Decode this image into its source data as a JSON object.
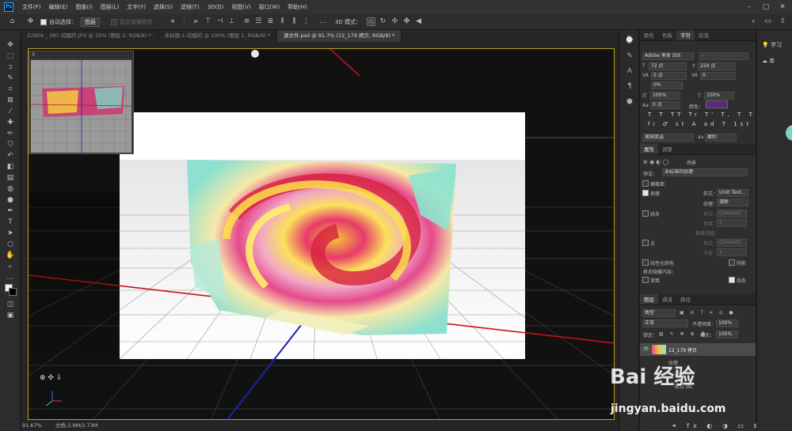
{
  "app": {
    "logo": "Ps"
  },
  "menubar": {
    "items": [
      "文件(F)",
      "编辑(E)",
      "图像(I)",
      "图层(L)",
      "文字(Y)",
      "选择(S)",
      "滤镜(T)",
      "3D(D)",
      "视图(V)",
      "窗口(W)",
      "帮助(H)"
    ]
  },
  "optionsbar": {
    "auto_select_label": "自动选择：",
    "auto_select_value": "图层",
    "show_transform_label": "显示变换控件",
    "mode_3d_label": "3D 模式："
  },
  "tabs": [
    {
      "label": "Z2809 _ 081-炫酷的.JPG @ 25% (图层 2, RGB/8) *",
      "active": false
    },
    {
      "label": "未标题-1-炫酷的 @ 100% (图层 1, RGB/8) *",
      "active": false
    },
    {
      "label": "源文件.psd @ 91.7% (12_179 拷贝, RGB/8) *",
      "active": true
    }
  ],
  "status": {
    "zoom": "91.67%",
    "doc_size": "文档:2.9M/2.73M"
  },
  "character_panel": {
    "tabs": [
      "颜色",
      "色板",
      "字符",
      "段落"
    ],
    "active_tab": "字符",
    "font_family": "Adobe 黑体 Std",
    "font_style": "-",
    "font_size": "72 点",
    "leading": "224 点",
    "kerning": "0 点",
    "tracking": "0",
    "scale_pct": "0%",
    "vert_scale": "100%",
    "horiz_scale": "100%",
    "baseline": "0 点",
    "color_label": "颜色：",
    "color_value": "#5a2a7a",
    "language": "美国英语",
    "aa": "犀利"
  },
  "properties_panel": {
    "tabs": [
      "属性",
      "调整"
    ],
    "active_tab": "属性",
    "sub_tab_label": "场景",
    "preset_label": "预设：",
    "preset_value": "未标准的纹理",
    "cross_section": "横截面",
    "surface_label": "表面",
    "style_label": "样式：",
    "style_value": "Unlit Text...",
    "texture_label": "纹理：",
    "texture_value": "漫射",
    "lines_label": "线条",
    "lines_style": "Constant",
    "lines_width_label": "宽度：",
    "lines_width": "1",
    "angle_label": "角度阈值：",
    "points_label": "点",
    "points_style": "Constant",
    "radius_label": "半径：",
    "radius_value": "1",
    "linearize_colors": "线性化颜色",
    "shadows_label": "阴影",
    "remove_hidden": "移去隐藏内容：",
    "backfaces": "背面",
    "lines_check": "线条"
  },
  "layers_panel": {
    "tabs": [
      "图层",
      "通道",
      "路径"
    ],
    "active_tab": "图层",
    "filter_label": "类型",
    "blend_mode": "正常",
    "opacity_label": "不透明度：",
    "opacity": "100%",
    "lock_label": "锁定：",
    "fill_label": "填充：",
    "fill": "100%",
    "layers": [
      {
        "name": "12_179 拷贝",
        "selected": true
      },
      {
        "name": "纹理",
        "selected": false
      },
      {
        "name": "漫射",
        "selected": false
      },
      {
        "name": "默认 IBL",
        "selected": false
      }
    ]
  },
  "far_panel": {
    "learn": "学习",
    "library": "库"
  },
  "watermark": {
    "brand": "Bai 经验",
    "url": "jingyan.baidu.com"
  },
  "colors": {
    "accent": "#31a8ff",
    "arrow": "#c0121a",
    "frame": "#b8a21a"
  }
}
